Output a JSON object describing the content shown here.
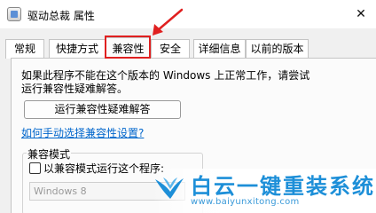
{
  "window": {
    "title": "驱动总裁 属性",
    "close_glyph": "✕"
  },
  "tabs": [
    {
      "label": "常规"
    },
    {
      "label": "快捷方式"
    },
    {
      "label": "兼容性",
      "selected": true
    },
    {
      "label": "安全"
    },
    {
      "label": "详细信息"
    },
    {
      "label": "以前的版本"
    }
  ],
  "compat": {
    "intro_line1": "如果此程序不能在这个版本的 Windows 上正常工作，请尝试",
    "intro_line2": "运行兼容性疑难解答。",
    "run_troubleshooter": "运行兼容性疑难解答",
    "manual_link": "如何手动选择兼容性设置?",
    "mode_group_title": "兼容模式",
    "mode_checkbox_label": "以兼容模式运行这个程序:",
    "mode_checkbox_checked": false,
    "os_select_value": "Windows 8"
  },
  "annotation": {
    "highlight_color": "#e02020"
  },
  "watermark": {
    "brand": "白云一键重装系统",
    "url": "www.baiyunxitong.com",
    "color": "#1d8fd8"
  }
}
